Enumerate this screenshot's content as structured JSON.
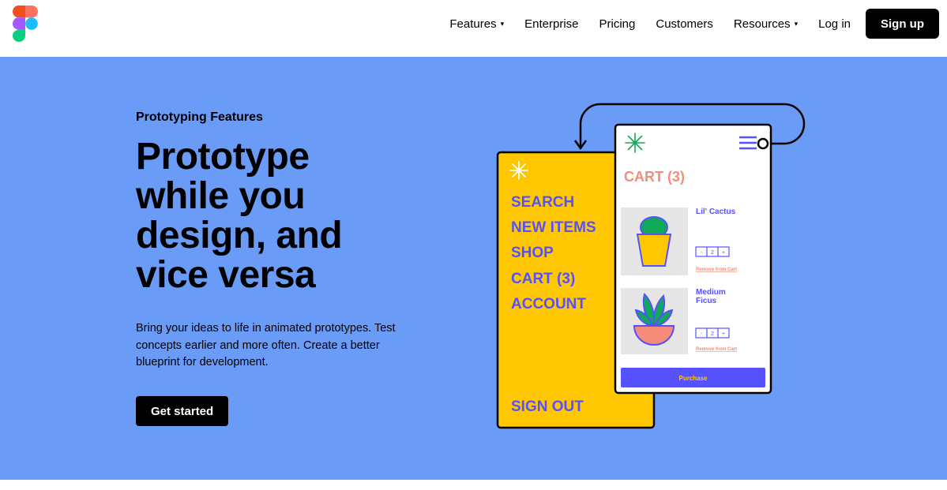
{
  "nav": {
    "items": [
      {
        "label": "Features",
        "caret": "▾"
      },
      {
        "label": "Enterprise"
      },
      {
        "label": "Pricing"
      },
      {
        "label": "Customers"
      },
      {
        "label": "Resources",
        "caret": "▾"
      },
      {
        "label": "Log in"
      }
    ],
    "signup_label": "Sign up"
  },
  "hero": {
    "eyebrow": "Prototyping Features",
    "headline_lines": [
      "Prototype",
      "while you",
      "design, and",
      "vice versa"
    ],
    "description": "Bring your ideas to life in animated prototypes. Test concepts earlier and more often. Create a better blueprint for development.",
    "cta_label": "Get started"
  },
  "illustration": {
    "menu": {
      "items": [
        "SEARCH",
        "NEW ITEMS",
        "SHOP",
        "CART (3)",
        "ACCOUNT"
      ],
      "footer": "SIGN OUT"
    },
    "cart": {
      "title": "CART (3)",
      "products": [
        {
          "name_lines": [
            "Lil' Cactus"
          ],
          "qty": {
            "minus": "-",
            "count": "2",
            "plus": "+"
          },
          "remove": "Remove from Cart"
        },
        {
          "name_lines": [
            "Medium",
            "Ficus"
          ],
          "qty": {
            "minus": "-",
            "count": "2",
            "plus": "+"
          },
          "remove": "Remove from Cart"
        }
      ],
      "purchase": "Purchase"
    }
  },
  "colors": {
    "hero_bg": "#699bf7",
    "menu_yellow": "#ffc700",
    "purple": "#5551ff",
    "coral": "#f58b79",
    "green": "#0fa958"
  }
}
